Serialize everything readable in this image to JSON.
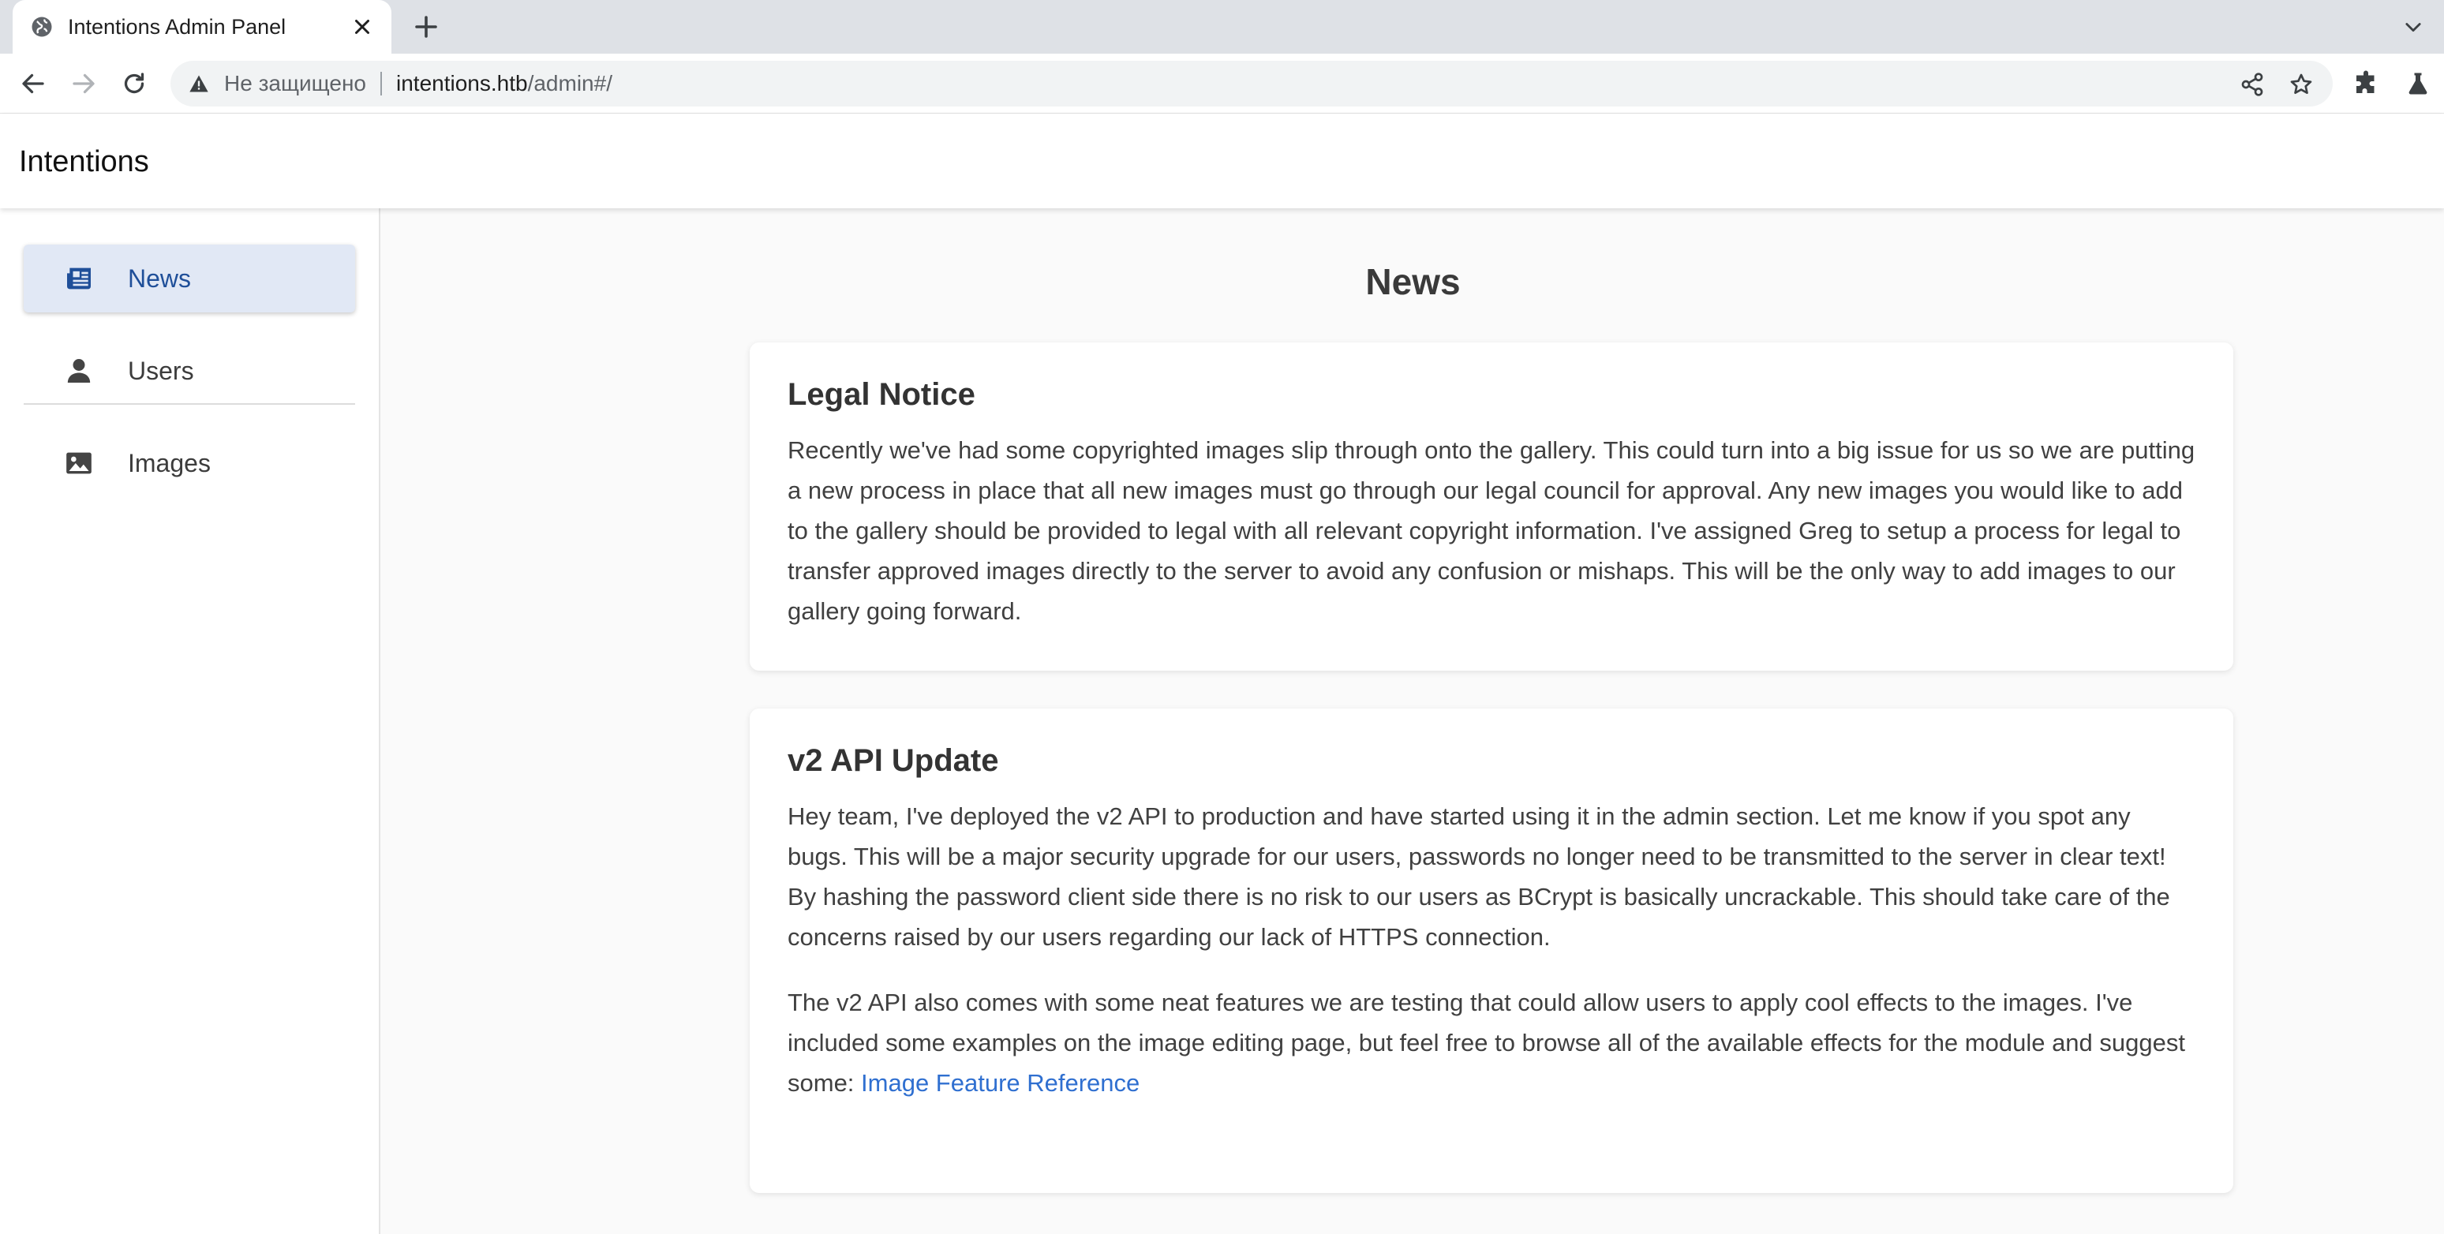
{
  "browser": {
    "tab_title": "Intentions Admin Panel",
    "security_label": "Не защищено",
    "url_host": "intentions.htb",
    "url_path": "/admin#/"
  },
  "app": {
    "title": "Intentions"
  },
  "sidebar": {
    "items": [
      {
        "label": "News",
        "icon": "newspaper-icon",
        "active": true
      },
      {
        "label": "Users",
        "icon": "person-icon",
        "active": false
      },
      {
        "label": "Images",
        "icon": "image-icon",
        "active": false
      }
    ]
  },
  "main": {
    "page_title": "News",
    "posts": [
      {
        "title": "Legal Notice",
        "paragraphs": [
          "Recently we've had some copyrighted images slip through onto the gallery. This could turn into a big issue for us so we are putting a new process in place that all new images must go through our legal council for approval. Any new images you would like to add to the gallery should be provided to legal with all relevant copyright information. I've assigned Greg to setup a process for legal to transfer approved images directly to the server to avoid any confusion or mishaps. This will be the only way to add images to our gallery going forward."
        ]
      },
      {
        "title": "v2 API Update",
        "paragraphs": [
          "Hey team, I've deployed the v2 API to production and have started using it in the admin section. Let me know if you spot any bugs. This will be a major security upgrade for our users, passwords no longer need to be transmitted to the server in clear text! By hashing the password client side there is no risk to our users as BCrypt is basically uncrackable. This should take care of the concerns raised by our users regarding our lack of HTTPS connection.",
          "The v2 API also comes with some neat features we are testing that could allow users to apply cool effects to the images. I've included some examples on the image editing page, but feel free to browse all of the available effects for the module and suggest some: "
        ],
        "link_text": "Image Feature Reference"
      }
    ]
  },
  "colors": {
    "accent": "#1f4f99",
    "active_bg": "#e1e8f5",
    "link": "#2f6fd0"
  }
}
